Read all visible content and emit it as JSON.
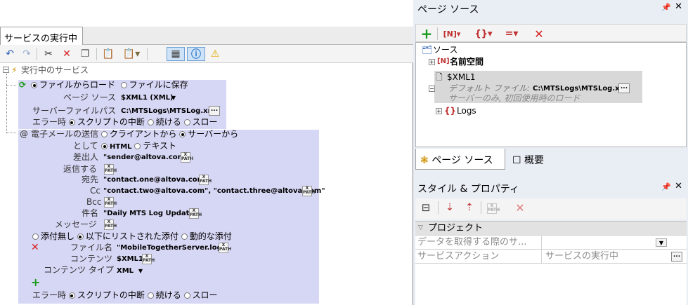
{
  "editor": {
    "tab_label": "サービスの実行中"
  },
  "tree": {
    "root_label": "実行中のサービス",
    "load": {
      "opt_load": "ファイルからロード",
      "opt_save": "ファイルに保存",
      "page_source_label": "ページ ソース",
      "page_source_value": "$XML1 (XML)",
      "server_path_label": "サーバーファイルパス",
      "server_path_value": "C:\\MTSLogs\\MTSLog.xml",
      "error_label": "エラー時",
      "err_opt1": "スクリプトの中断",
      "err_opt2": "続ける",
      "err_opt3": "スロー"
    },
    "email": {
      "label": "電子メールの送信",
      "opt_client": "クライアントから",
      "opt_server": "サーバーから",
      "as_label": "として",
      "opt_html": "HTML",
      "opt_text": "テキスト",
      "from_label": "差出人",
      "from_value": "\"sender@altova.com\"",
      "reply_label": "返信する",
      "to_label": "宛先",
      "to_value": "\"contact.one@altova.com\"",
      "cc_label": "Cc",
      "cc_value": "\"contact.two@altova.com\", \"contact.three@altova.com\"",
      "bcc_label": "Bcc",
      "subject_label": "件名",
      "subject_value": "\"Daily MTS Log Update\"",
      "message_label": "メッセージ",
      "att_none": "添付無し",
      "att_list": "以下にリストされた添付",
      "att_dynamic": "動的な添付",
      "filename_label": "ファイル名",
      "filename_value": "\"MobileTogetherServer.log\"",
      "content_label": "コンテンツ",
      "content_value": "$XML1",
      "content_type_label": "コンテンツ タイプ",
      "content_type_value": "XML",
      "error_label": "エラー時",
      "err_opt1": "スクリプトの中断",
      "err_opt2": "続ける",
      "err_opt3": "スロー"
    },
    "xpath_icon_line1": "X",
    "xpath_icon_line2": "PATH"
  },
  "page_source_panel": {
    "title": "ページ ソース",
    "tree": {
      "root": "ソース",
      "namespaces": "名前空間",
      "xml1": "$XML1",
      "default_file_label": "デフォルト ファイル:",
      "default_file_value": "C:\\MTSLogs\\MTSLog.xml",
      "note": "サーバーのみ, 初回使用時のロード",
      "logs": "Logs"
    },
    "tabs": [
      {
        "label": "ページ ソース"
      },
      {
        "label": "概要"
      }
    ]
  },
  "styles_panel": {
    "title": "スタイル & プロパティ",
    "section": "プロジェクト",
    "rows": [
      {
        "name": "データを取得する際のサ...",
        "value": ""
      },
      {
        "name": "サービスアクション",
        "value": "サービスの実行中"
      }
    ]
  },
  "colors": {
    "block_bg": "#d6d6f5",
    "add_green": "#1a9a1a",
    "delete_red": "#d42020",
    "info_blue": "#2a76c8"
  }
}
